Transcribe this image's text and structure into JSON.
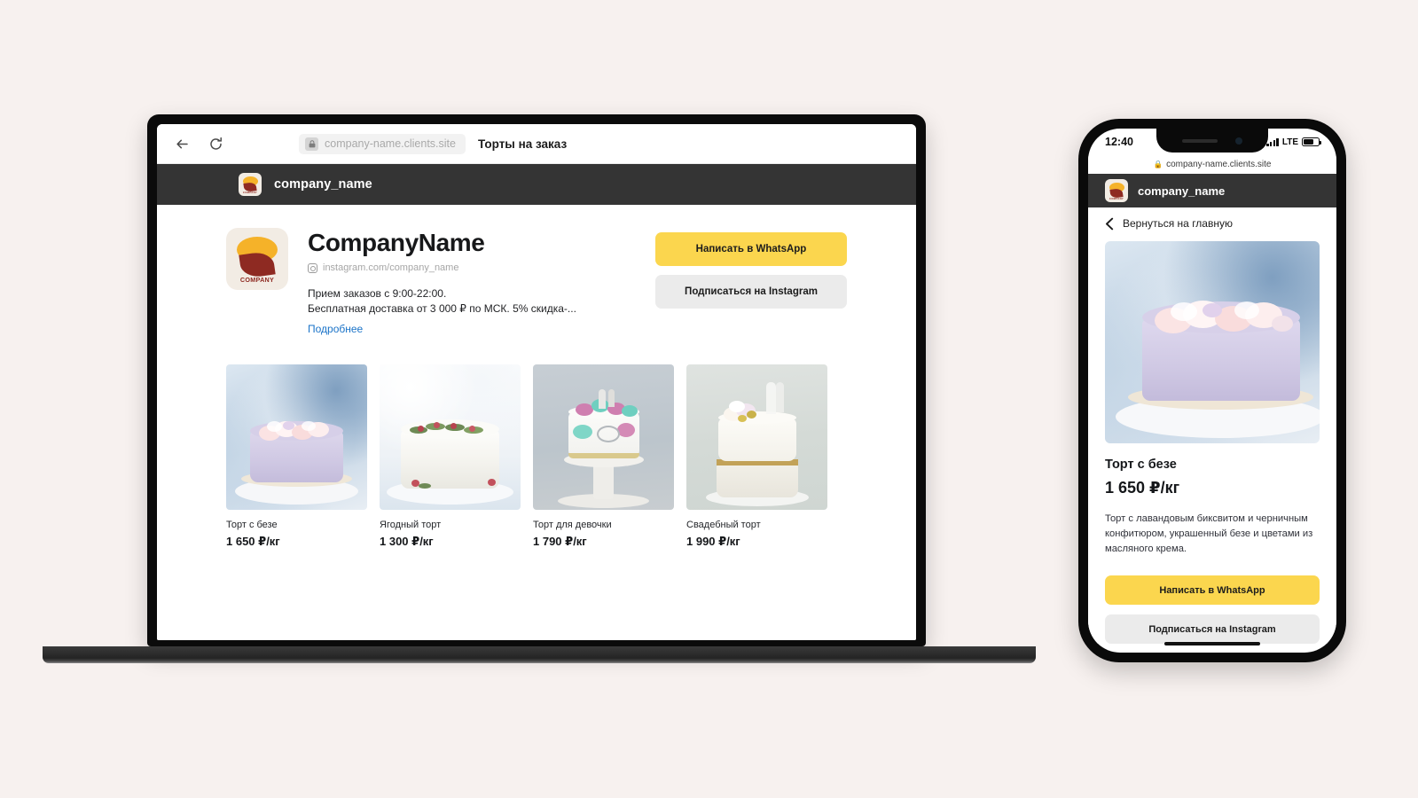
{
  "canvas": {
    "background": "#f7f1ef"
  },
  "browser": {
    "back_icon": "back-arrow-icon",
    "reload_icon": "reload-icon",
    "lock_icon": "lock-icon",
    "url": "company-name.clients.site",
    "tab_title": "Торты на заказ"
  },
  "site_header": {
    "logo_word": "COMPANY",
    "brand": "company_name"
  },
  "profile": {
    "logo_word": "COMPANY",
    "title": "CompanyName",
    "instagram_icon": "instagram-icon",
    "instagram_handle": "instagram.com/company_name",
    "about_line_1": "Прием заказов с 9:00-22:00.",
    "about_line_2": "Бесплатная доставка от 3 000 ₽ по МСК. 5% скидка-...",
    "more_link": "Подробнее"
  },
  "cta": {
    "whatsapp": "Написать в WhatsApp",
    "instagram": "Подписаться на Instagram",
    "whatsapp_color": "#fbd64e",
    "instagram_color": "#ebebeb"
  },
  "products": [
    {
      "name": "Торт с безе",
      "price": "1 650 ₽/кг",
      "art": "lavender"
    },
    {
      "name": "Ягодный торт",
      "price": "1 300 ₽/кг",
      "art": "berry"
    },
    {
      "name": "Торт для девочки",
      "price": "1 790 ₽/кг",
      "art": "girl"
    },
    {
      "name": "Свадебный торт",
      "price": "1 990 ₽/кг",
      "art": "wedding"
    }
  ],
  "phone": {
    "status": {
      "time": "12:40",
      "signal_icon": "signal-bars-icon",
      "network": "LTE",
      "battery_icon": "battery-icon"
    },
    "url": "company-name.clients.site",
    "lock_icon": "lock-icon",
    "header": {
      "logo_word": "COMPANY",
      "brand": "company_name"
    },
    "back": {
      "icon": "chevron-left-icon",
      "label": "Вернуться на главную"
    },
    "product": {
      "name": "Торт с безе",
      "price": "1 650 ₽/кг",
      "description": "Торт с лавандовым биксвитом и черничным конфитюром, украшенный безе и цветами из масляного крема."
    },
    "cta": {
      "whatsapp": "Написать в WhatsApp",
      "instagram": "Подписаться на Instagram"
    }
  }
}
